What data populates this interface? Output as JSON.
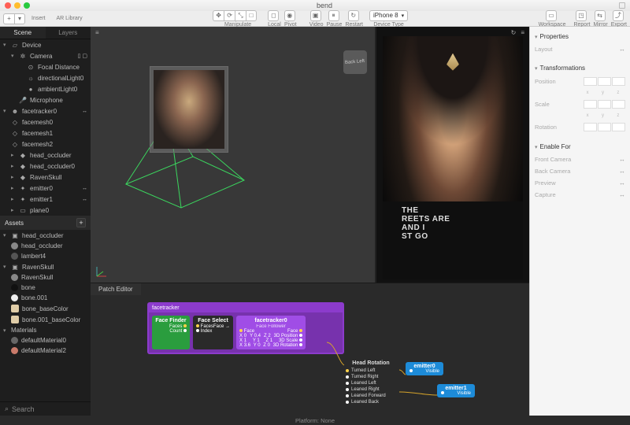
{
  "window": {
    "title": "bend"
  },
  "toolbar": {
    "insert": "Insert",
    "arlib": "AR Library",
    "manip": "Manipulate",
    "local": "Local",
    "pivot": "Pivot",
    "video": "Video",
    "pause": "Pause",
    "restart": "Restart",
    "device_option": "iPhone 8",
    "device_type": "Device Type",
    "workspace": "Workspace",
    "report": "Report",
    "mirror": "Mirror",
    "export": "Export"
  },
  "left": {
    "tab_scene": "Scene",
    "tab_layers": "Layers",
    "scene_items": {
      "device": "Device",
      "camera": "Camera",
      "focal": "Focal Distance",
      "dirlight": "directionalLight0",
      "amblight": "ambientLight0",
      "microphone": "Microphone",
      "facetracker": "facetracker0",
      "facemesh0": "facemesh0",
      "facemesh1": "facemesh1",
      "facemesh2": "facemesh2",
      "head_occ": "head_occluder",
      "head_occ0": "head_occluder0",
      "raven": "RavenSkull",
      "emit0": "emitter0",
      "emit1": "emitter1",
      "plane0": "plane0"
    },
    "assets_head": "Assets",
    "assets": {
      "head_occ_grp": "head_occluder",
      "head_occ": "head_occluder",
      "lambert": "lambert4",
      "raven_grp": "RavenSkull",
      "raven": "RavenSkull",
      "bone": "bone",
      "bone001": "bone.001",
      "bone_base": "bone_baseColor",
      "bone001_base": "bone.001_baseColor",
      "materials": "Materials",
      "defmat0": "defaultMaterial0",
      "defmat2": "defaultMaterial2"
    },
    "search": "Search"
  },
  "patch": {
    "tab": "Patch Editor",
    "group_title": "facetracker",
    "finder": {
      "title": "Face Finder",
      "faces": "Faces",
      "count": "Count"
    },
    "select": {
      "title": "Face Select",
      "faces": "Faces",
      "index": "Index",
      "face": "Face →"
    },
    "tracker": {
      "title": "facetracker0",
      "sub": "Face Follower",
      "inputs": [
        "Face"
      ],
      "outputs": [
        "Face",
        "3D Position",
        "3D Scale",
        "3D Rotation"
      ],
      "vals": [
        "X 0",
        "Y 0.4",
        "Z 2",
        "X 1",
        "Y 1",
        "Z 1",
        "X 3.6",
        "Y 0",
        "Z 0"
      ]
    },
    "headrot": {
      "title": "Head Rotation",
      "rows": [
        "Turned Left",
        "Turned Right",
        "Leaned Left",
        "Leaned Right",
        "Leaned Forward",
        "Leaned Back"
      ]
    },
    "em0": {
      "title": "emitter0",
      "prop": "Visible"
    },
    "em1": {
      "title": "emitter1",
      "prop": "Visible"
    }
  },
  "shirt_lines": [
    "THE",
    "REETS ARE",
    "AND I",
    "ST GO"
  ],
  "right": {
    "properties": "Properties",
    "layout": "Layout",
    "transforms": "Transformations",
    "pos": "Position",
    "scale": "Scale",
    "rot": "Rotation",
    "x": "x",
    "y": "y",
    "z": "z",
    "enablefor": "Enable For",
    "front": "Front Camera",
    "back": "Back Camera",
    "preview": "Preview",
    "capture": "Capture"
  },
  "status": {
    "platform": "Platform: None"
  }
}
